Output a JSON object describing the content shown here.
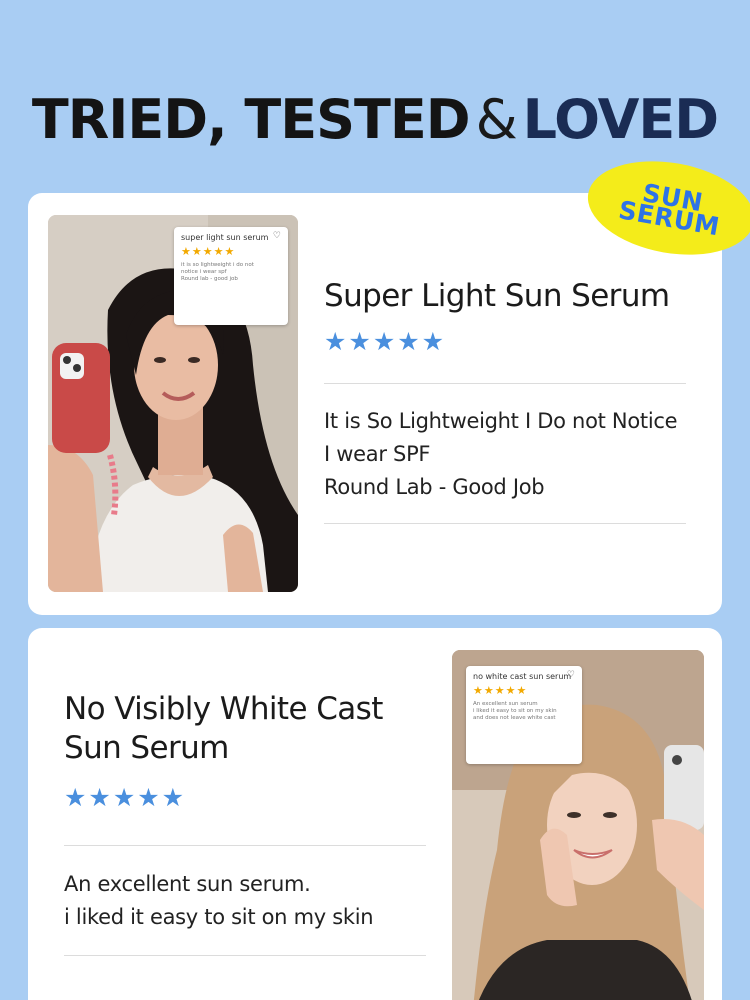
{
  "headline": {
    "part1": "TRIED, TESTED",
    "amp": "&",
    "part2": "LOVED"
  },
  "sticker": {
    "line1": "SUN",
    "line2": "SERUM"
  },
  "reviews": [
    {
      "title": "Super Light Sun Serum",
      "stars": "★★★★★",
      "body": [
        "It is So Lightweight I Do not Notice",
        "I wear SPF",
        "Round Lab - Good Job"
      ],
      "photo_card": {
        "title": "super light sun serum",
        "stars": "★★★★★",
        "body": [
          "it is so lightweight i do not",
          "notice i wear spf",
          "Round lab - good job"
        ]
      }
    },
    {
      "title_lines": [
        "No Visibly White Cast",
        "Sun Serum"
      ],
      "stars": "★★★★★",
      "body": [
        "An excellent sun serum.",
        "i liked it easy to sit on my skin"
      ],
      "photo_card": {
        "title": "no white cast sun serum",
        "stars": "★★★★★",
        "body": [
          "An excellent sun serum",
          "i liked it easy to sit on my skin",
          "and does not leave white cast"
        ]
      }
    }
  ],
  "colors": {
    "background": "#a9cdf3",
    "sticker": "#f4ec1a",
    "sticker_text": "#2e73e6",
    "stars": "#4a8fde",
    "mini_stars": "#f2a900",
    "headline_accent": "#1a2c54"
  },
  "icons": {
    "heart": "heart-icon",
    "star": "star-icon"
  }
}
